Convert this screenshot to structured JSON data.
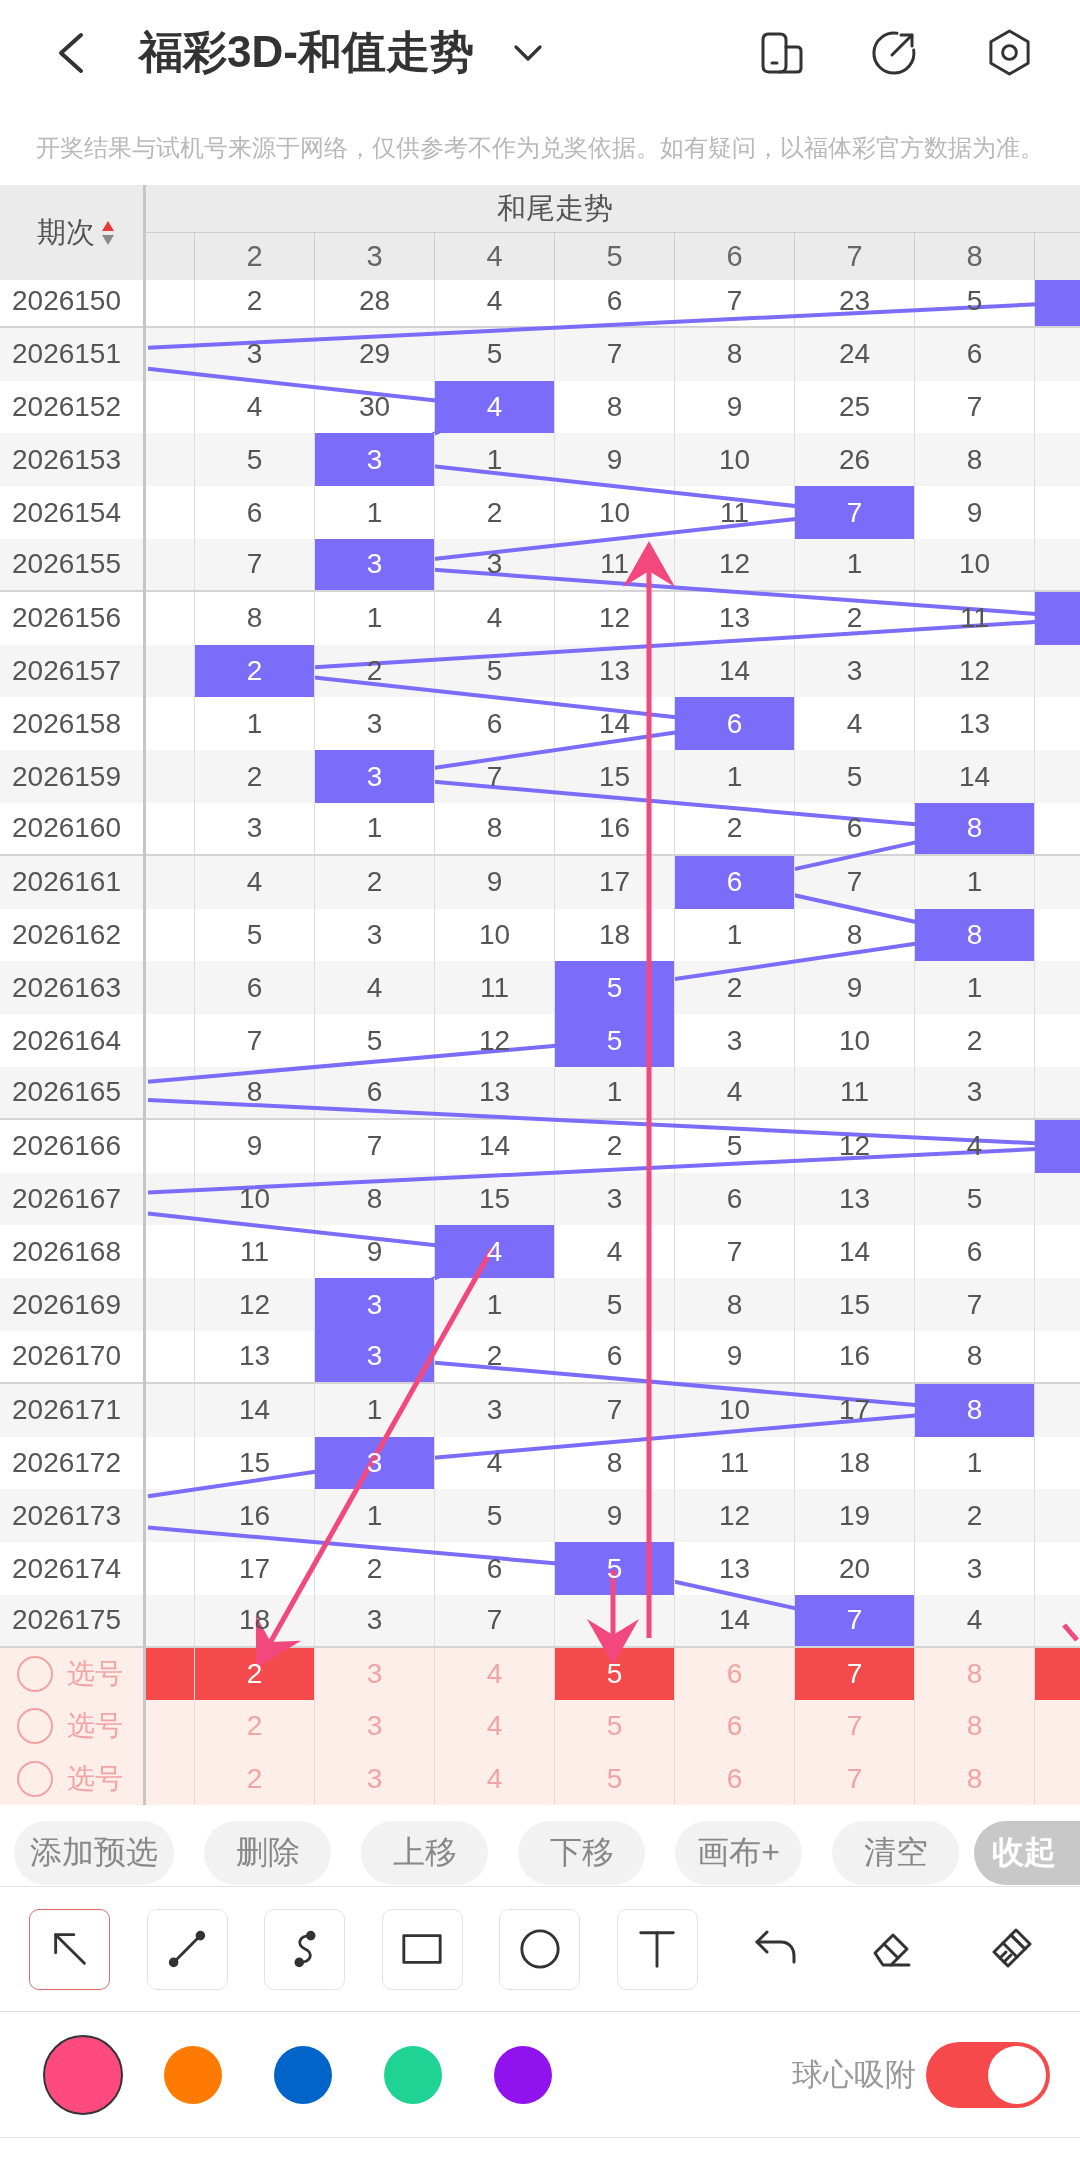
{
  "top_bar": {
    "title": "福彩3D-和值走势"
  },
  "notice": "开奖结果与试机号来源于网络，仅供参考不作为兑奖依据。如有疑问，以福体彩官方数据为准。",
  "trend_table": {
    "period_header": "期次",
    "sort_ascending": true,
    "group_title": "和尾走势",
    "columns": [
      "2",
      "3",
      "4",
      "5",
      "6",
      "7",
      "8"
    ],
    "rows": [
      {
        "period": "2026150",
        "cells": [
          {
            "value": "2",
            "hit": false
          },
          {
            "value": "28",
            "hit": false
          },
          {
            "value": "4",
            "hit": false
          },
          {
            "value": "6",
            "hit": false
          },
          {
            "value": "7",
            "hit": false
          },
          {
            "value": "23",
            "hit": false
          },
          {
            "value": "5",
            "hit": false
          }
        ],
        "edge_hit_right": true
      },
      {
        "period": "2026151",
        "cells": [
          {
            "value": "3",
            "hit": false
          },
          {
            "value": "29",
            "hit": false
          },
          {
            "value": "5",
            "hit": false
          },
          {
            "value": "7",
            "hit": false
          },
          {
            "value": "8",
            "hit": false
          },
          {
            "value": "24",
            "hit": false
          },
          {
            "value": "6",
            "hit": false
          }
        ],
        "edge_hit_right": false
      },
      {
        "period": "2026152",
        "cells": [
          {
            "value": "4",
            "hit": false
          },
          {
            "value": "30",
            "hit": false
          },
          {
            "value": "4",
            "hit": true
          },
          {
            "value": "8",
            "hit": false
          },
          {
            "value": "9",
            "hit": false
          },
          {
            "value": "25",
            "hit": false
          },
          {
            "value": "7",
            "hit": false
          }
        ],
        "edge_hit_right": false
      },
      {
        "period": "2026153",
        "cells": [
          {
            "value": "5",
            "hit": false
          },
          {
            "value": "3",
            "hit": true
          },
          {
            "value": "1",
            "hit": false
          },
          {
            "value": "9",
            "hit": false
          },
          {
            "value": "10",
            "hit": false
          },
          {
            "value": "26",
            "hit": false
          },
          {
            "value": "8",
            "hit": false
          }
        ],
        "edge_hit_right": false
      },
      {
        "period": "2026154",
        "cells": [
          {
            "value": "6",
            "hit": false
          },
          {
            "value": "1",
            "hit": false
          },
          {
            "value": "2",
            "hit": false
          },
          {
            "value": "10",
            "hit": false
          },
          {
            "value": "11",
            "hit": false
          },
          {
            "value": "7",
            "hit": true
          },
          {
            "value": "9",
            "hit": false
          }
        ],
        "edge_hit_right": false
      },
      {
        "period": "2026155",
        "cells": [
          {
            "value": "7",
            "hit": false
          },
          {
            "value": "3",
            "hit": true
          },
          {
            "value": "3",
            "hit": false
          },
          {
            "value": "11",
            "hit": false
          },
          {
            "value": "12",
            "hit": false
          },
          {
            "value": "1",
            "hit": false
          },
          {
            "value": "10",
            "hit": false
          }
        ],
        "edge_hit_right": false
      },
      {
        "period": "2026156",
        "cells": [
          {
            "value": "8",
            "hit": false
          },
          {
            "value": "1",
            "hit": false
          },
          {
            "value": "4",
            "hit": false
          },
          {
            "value": "12",
            "hit": false
          },
          {
            "value": "13",
            "hit": false
          },
          {
            "value": "2",
            "hit": false
          },
          {
            "value": "11",
            "hit": false
          }
        ],
        "edge_hit_right": true
      },
      {
        "period": "2026157",
        "cells": [
          {
            "value": "2",
            "hit": true
          },
          {
            "value": "2",
            "hit": false
          },
          {
            "value": "5",
            "hit": false
          },
          {
            "value": "13",
            "hit": false
          },
          {
            "value": "14",
            "hit": false
          },
          {
            "value": "3",
            "hit": false
          },
          {
            "value": "12",
            "hit": false
          }
        ],
        "edge_hit_right": false
      },
      {
        "period": "2026158",
        "cells": [
          {
            "value": "1",
            "hit": false
          },
          {
            "value": "3",
            "hit": false
          },
          {
            "value": "6",
            "hit": false
          },
          {
            "value": "14",
            "hit": false
          },
          {
            "value": "6",
            "hit": true
          },
          {
            "value": "4",
            "hit": false
          },
          {
            "value": "13",
            "hit": false
          }
        ],
        "edge_hit_right": false
      },
      {
        "period": "2026159",
        "cells": [
          {
            "value": "2",
            "hit": false
          },
          {
            "value": "3",
            "hit": true
          },
          {
            "value": "7",
            "hit": false
          },
          {
            "value": "15",
            "hit": false
          },
          {
            "value": "1",
            "hit": false
          },
          {
            "value": "5",
            "hit": false
          },
          {
            "value": "14",
            "hit": false
          }
        ],
        "edge_hit_right": false
      },
      {
        "period": "2026160",
        "cells": [
          {
            "value": "3",
            "hit": false
          },
          {
            "value": "1",
            "hit": false
          },
          {
            "value": "8",
            "hit": false
          },
          {
            "value": "16",
            "hit": false
          },
          {
            "value": "2",
            "hit": false
          },
          {
            "value": "6",
            "hit": false
          },
          {
            "value": "8",
            "hit": true
          }
        ],
        "edge_hit_right": false
      },
      {
        "period": "2026161",
        "cells": [
          {
            "value": "4",
            "hit": false
          },
          {
            "value": "2",
            "hit": false
          },
          {
            "value": "9",
            "hit": false
          },
          {
            "value": "17",
            "hit": false
          },
          {
            "value": "6",
            "hit": true
          },
          {
            "value": "7",
            "hit": false
          },
          {
            "value": "1",
            "hit": false
          }
        ],
        "edge_hit_right": false
      },
      {
        "period": "2026162",
        "cells": [
          {
            "value": "5",
            "hit": false
          },
          {
            "value": "3",
            "hit": false
          },
          {
            "value": "10",
            "hit": false
          },
          {
            "value": "18",
            "hit": false
          },
          {
            "value": "1",
            "hit": false
          },
          {
            "value": "8",
            "hit": false
          },
          {
            "value": "8",
            "hit": true
          }
        ],
        "edge_hit_right": false
      },
      {
        "period": "2026163",
        "cells": [
          {
            "value": "6",
            "hit": false
          },
          {
            "value": "4",
            "hit": false
          },
          {
            "value": "11",
            "hit": false
          },
          {
            "value": "5",
            "hit": true
          },
          {
            "value": "2",
            "hit": false
          },
          {
            "value": "9",
            "hit": false
          },
          {
            "value": "1",
            "hit": false
          }
        ],
        "edge_hit_right": false
      },
      {
        "period": "2026164",
        "cells": [
          {
            "value": "7",
            "hit": false
          },
          {
            "value": "5",
            "hit": false
          },
          {
            "value": "12",
            "hit": false
          },
          {
            "value": "5",
            "hit": true
          },
          {
            "value": "3",
            "hit": false
          },
          {
            "value": "10",
            "hit": false
          },
          {
            "value": "2",
            "hit": false
          }
        ],
        "edge_hit_right": false
      },
      {
        "period": "2026165",
        "cells": [
          {
            "value": "8",
            "hit": false
          },
          {
            "value": "6",
            "hit": false
          },
          {
            "value": "13",
            "hit": false
          },
          {
            "value": "1",
            "hit": false
          },
          {
            "value": "4",
            "hit": false
          },
          {
            "value": "11",
            "hit": false
          },
          {
            "value": "3",
            "hit": false
          }
        ],
        "edge_hit_right": false
      },
      {
        "period": "2026166",
        "cells": [
          {
            "value": "9",
            "hit": false
          },
          {
            "value": "7",
            "hit": false
          },
          {
            "value": "14",
            "hit": false
          },
          {
            "value": "2",
            "hit": false
          },
          {
            "value": "5",
            "hit": false
          },
          {
            "value": "12",
            "hit": false
          },
          {
            "value": "4",
            "hit": false
          }
        ],
        "edge_hit_right": true
      },
      {
        "period": "2026167",
        "cells": [
          {
            "value": "10",
            "hit": false
          },
          {
            "value": "8",
            "hit": false
          },
          {
            "value": "15",
            "hit": false
          },
          {
            "value": "3",
            "hit": false
          },
          {
            "value": "6",
            "hit": false
          },
          {
            "value": "13",
            "hit": false
          },
          {
            "value": "5",
            "hit": false
          }
        ],
        "edge_hit_right": false
      },
      {
        "period": "2026168",
        "cells": [
          {
            "value": "11",
            "hit": false
          },
          {
            "value": "9",
            "hit": false
          },
          {
            "value": "4",
            "hit": true
          },
          {
            "value": "4",
            "hit": false
          },
          {
            "value": "7",
            "hit": false
          },
          {
            "value": "14",
            "hit": false
          },
          {
            "value": "6",
            "hit": false
          }
        ],
        "edge_hit_right": false
      },
      {
        "period": "2026169",
        "cells": [
          {
            "value": "12",
            "hit": false
          },
          {
            "value": "3",
            "hit": true
          },
          {
            "value": "1",
            "hit": false
          },
          {
            "value": "5",
            "hit": false
          },
          {
            "value": "8",
            "hit": false
          },
          {
            "value": "15",
            "hit": false
          },
          {
            "value": "7",
            "hit": false
          }
        ],
        "edge_hit_right": false
      },
      {
        "period": "2026170",
        "cells": [
          {
            "value": "13",
            "hit": false
          },
          {
            "value": "3",
            "hit": true
          },
          {
            "value": "2",
            "hit": false
          },
          {
            "value": "6",
            "hit": false
          },
          {
            "value": "9",
            "hit": false
          },
          {
            "value": "16",
            "hit": false
          },
          {
            "value": "8",
            "hit": false
          }
        ],
        "edge_hit_right": false
      },
      {
        "period": "2026171",
        "cells": [
          {
            "value": "14",
            "hit": false
          },
          {
            "value": "1",
            "hit": false
          },
          {
            "value": "3",
            "hit": false
          },
          {
            "value": "7",
            "hit": false
          },
          {
            "value": "10",
            "hit": false
          },
          {
            "value": "17",
            "hit": false
          },
          {
            "value": "8",
            "hit": true
          }
        ],
        "edge_hit_right": false
      },
      {
        "period": "2026172",
        "cells": [
          {
            "value": "15",
            "hit": false
          },
          {
            "value": "3",
            "hit": true
          },
          {
            "value": "4",
            "hit": false
          },
          {
            "value": "8",
            "hit": false
          },
          {
            "value": "11",
            "hit": false
          },
          {
            "value": "18",
            "hit": false
          },
          {
            "value": "1",
            "hit": false
          }
        ],
        "edge_hit_right": false
      },
      {
        "period": "2026173",
        "cells": [
          {
            "value": "16",
            "hit": false
          },
          {
            "value": "1",
            "hit": false
          },
          {
            "value": "5",
            "hit": false
          },
          {
            "value": "9",
            "hit": false
          },
          {
            "value": "12",
            "hit": false
          },
          {
            "value": "19",
            "hit": false
          },
          {
            "value": "2",
            "hit": false
          }
        ],
        "edge_hit_right": false
      },
      {
        "period": "2026174",
        "cells": [
          {
            "value": "17",
            "hit": false
          },
          {
            "value": "2",
            "hit": false
          },
          {
            "value": "6",
            "hit": false
          },
          {
            "value": "5",
            "hit": true
          },
          {
            "value": "13",
            "hit": false
          },
          {
            "value": "20",
            "hit": false
          },
          {
            "value": "3",
            "hit": false
          }
        ],
        "edge_hit_right": false
      },
      {
        "period": "2026175",
        "cells": [
          {
            "value": "18",
            "hit": false
          },
          {
            "value": "3",
            "hit": false
          },
          {
            "value": "7",
            "hit": false
          },
          {
            "hit": false
          },
          {
            "value": "14",
            "hit": false
          },
          {
            "value": "7",
            "hit": true
          },
          {
            "value": "4",
            "hit": false
          }
        ],
        "edge_hit_right": false
      }
    ],
    "pick_rows": [
      {
        "label": "选号",
        "checked": false,
        "left_edge_selected": true,
        "right_edge_selected": true,
        "cells": [
          {
            "value": "2",
            "selected": true
          },
          {
            "value": "3",
            "selected": false
          },
          {
            "value": "4",
            "selected": false
          },
          {
            "value": "5",
            "selected": true
          },
          {
            "value": "6",
            "selected": false
          },
          {
            "value": "7",
            "selected": true
          },
          {
            "value": "8",
            "selected": false
          }
        ]
      },
      {
        "label": "选号",
        "checked": false,
        "left_edge_selected": false,
        "right_edge_selected": false,
        "cells": [
          {
            "value": "2",
            "selected": false
          },
          {
            "value": "3",
            "selected": false
          },
          {
            "value": "4",
            "selected": false
          },
          {
            "value": "5",
            "selected": false
          },
          {
            "value": "6",
            "selected": false
          },
          {
            "value": "7",
            "selected": false
          },
          {
            "value": "8",
            "selected": false
          }
        ]
      },
      {
        "label": "选号",
        "checked": false,
        "left_edge_selected": false,
        "right_edge_selected": false,
        "cells": [
          {
            "value": "2",
            "selected": false
          },
          {
            "value": "3",
            "selected": false
          },
          {
            "value": "4",
            "selected": false
          },
          {
            "value": "5",
            "selected": false
          },
          {
            "value": "6",
            "selected": false
          },
          {
            "value": "7",
            "selected": false
          },
          {
            "value": "8",
            "selected": false
          }
        ]
      }
    ]
  },
  "actions": [
    {
      "label": "添加预选",
      "kind": "normal"
    },
    {
      "label": "删除",
      "kind": "normal"
    },
    {
      "label": "上移",
      "kind": "normal"
    },
    {
      "label": "下移",
      "kind": "normal"
    },
    {
      "label": "画布+",
      "kind": "normal"
    },
    {
      "label": "清空",
      "kind": "normal"
    },
    {
      "label": "收起",
      "kind": "collapse"
    }
  ],
  "drawing_tools": [
    {
      "kind": "tool",
      "selected": true
    },
    {
      "kind": "tool",
      "selected": false
    },
    {
      "kind": "tool",
      "selected": false
    },
    {
      "kind": "tool",
      "selected": false
    },
    {
      "kind": "tool",
      "selected": false
    },
    {
      "kind": "tool",
      "selected": false
    },
    {
      "kind": "action"
    },
    {
      "kind": "action"
    },
    {
      "kind": "action"
    }
  ],
  "palette": [
    {
      "color": "#ff4a80",
      "selected": true
    },
    {
      "color": "#ff7a00",
      "selected": false
    },
    {
      "color": "#0064c8",
      "selected": false
    },
    {
      "color": "#1ed394",
      "selected": false
    },
    {
      "color": "#9013ee",
      "selected": false
    }
  ],
  "snap": {
    "label": "球心吸附",
    "on": true
  }
}
